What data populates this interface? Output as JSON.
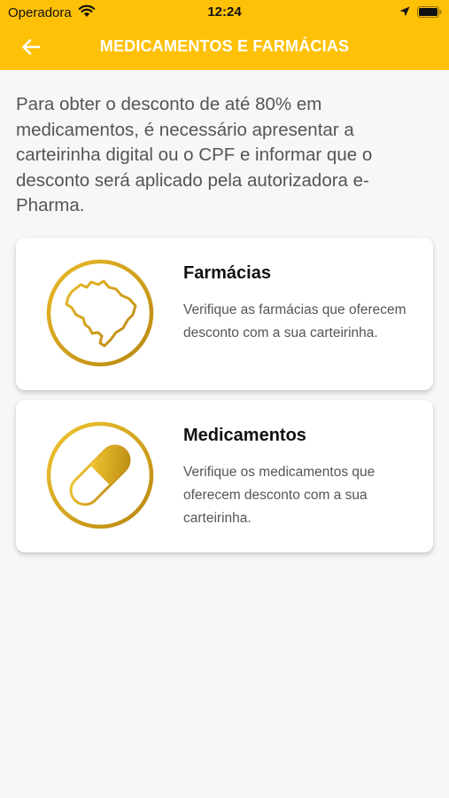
{
  "status_bar": {
    "carrier": "Operadora",
    "time": "12:24"
  },
  "header": {
    "title": "MEDICAMENTOS E FARMÁCIAS",
    "back_icon": "arrow-left-icon"
  },
  "colors": {
    "accent": "#ffc107",
    "gold": "#d4a20f",
    "background": "#f6f7f9"
  },
  "intro": {
    "text": "Para obter o desconto de até 80% em medicamentos, é necessário apresentar a carteirinha digital ou o CPF e informar que o desconto será aplicado pela autorizadora e-Pharma."
  },
  "cards": [
    {
      "icon": "brazil-map-icon",
      "title": "Farmácias",
      "description": "Verifique as farmácias que oferecem desconto com a sua carteirinha."
    },
    {
      "icon": "pill-capsule-icon",
      "title": "Medicamentos",
      "description": "Verifique os medicamentos que oferecem desconto com a sua carteirinha."
    }
  ]
}
